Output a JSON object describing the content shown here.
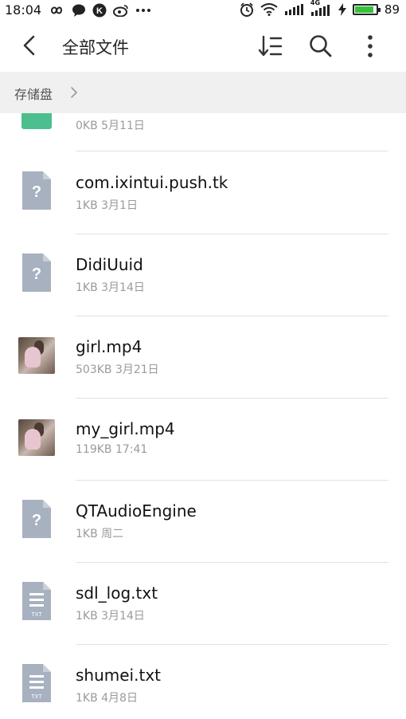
{
  "status_bar": {
    "time": "18:04",
    "battery_level": "89",
    "battery_percent": 89,
    "signal_label": "4G",
    "accent": "#35c23a"
  },
  "app_bar": {
    "title": "全部文件",
    "back_icon": "chevron-left-icon",
    "sort_icon": "sort-icon",
    "search_icon": "search-icon",
    "more_icon": "more-vertical-icon"
  },
  "breadcrumb": {
    "root": "存储盘"
  },
  "files": [
    {
      "name": "",
      "meta": "0KB  5月11日",
      "type": "folder"
    },
    {
      "name": "com.ixintui.push.tk",
      "meta": "1KB  3月1日",
      "type": "unknown"
    },
    {
      "name": "DidiUuid",
      "meta": "1KB  3月14日",
      "type": "unknown"
    },
    {
      "name": "girl.mp4",
      "meta": "503KB  3月21日",
      "type": "video"
    },
    {
      "name": "my_girl.mp4",
      "meta": "119KB  17:41",
      "type": "video"
    },
    {
      "name": "QTAudioEngine",
      "meta": "1KB  周二",
      "type": "unknown"
    },
    {
      "name": "sdl_log.txt",
      "meta": "1KB  3月14日",
      "type": "txt"
    },
    {
      "name": "shumei.txt",
      "meta": "1KB  4月8日",
      "type": "txt"
    }
  ],
  "icons": {
    "unknown_glyph": "?",
    "txt_badge": "TXT"
  },
  "colors": {
    "doc_icon": "#a7b1bf",
    "folder": "#4bbf8e"
  }
}
